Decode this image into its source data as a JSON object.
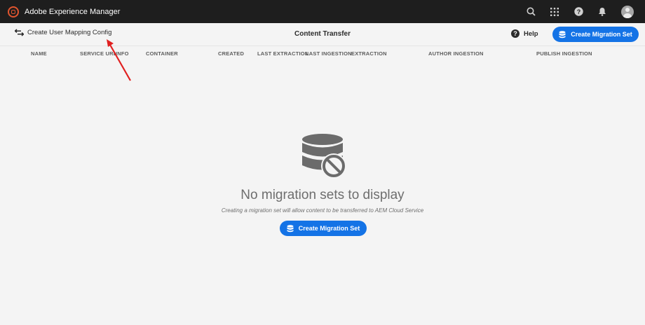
{
  "app": {
    "title": "Adobe Experience Manager"
  },
  "topbar": {
    "icons": [
      "search-icon",
      "apps-grid-icon",
      "help-icon",
      "bell-icon",
      "user-avatar"
    ]
  },
  "actionbar": {
    "back_label": "Create User Mapping Config",
    "page_title": "Content Transfer",
    "help_label": "Help",
    "create_label": "Create Migration Set"
  },
  "table": {
    "columns": [
      "NAME",
      "SERVICE URL",
      "INFO",
      "CONTAINER",
      "CREATED",
      "LAST EXTRACTION",
      "LAST INGESTION",
      "EXTRACTION",
      "AUTHOR INGESTION",
      "PUBLISH INGESTION"
    ]
  },
  "empty_state": {
    "title": "No migration sets to display",
    "subtitle": "Creating a migration set will allow content to be transferred to AEM Cloud Service",
    "button_label": "Create Migration Set"
  },
  "colors": {
    "topbar_bg": "#1e1e1e",
    "accent_blue": "#1473e6",
    "logo_orange": "#e1552f",
    "annotation_red": "#e02020"
  }
}
